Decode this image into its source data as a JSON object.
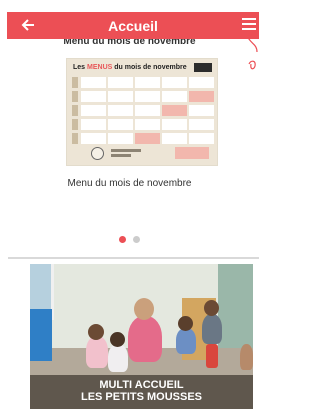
{
  "header": {
    "title": "Accueil",
    "back_icon": "arrow-left-icon",
    "menu_icon": "hamburger-icon",
    "bar_color": "#ec4f55"
  },
  "section": {
    "title": "Menu du mois de novembre"
  },
  "menu_card": {
    "image_heading_prefix": "Les",
    "image_heading_highlight": "MENUS",
    "image_heading_suffix": "du mois de novembre",
    "caption": "Menu du mois de novembre"
  },
  "carousel": {
    "count": 2,
    "active_index": 0,
    "active_color": "#ec4f55",
    "inactive_color": "#cccccc"
  },
  "photo_card": {
    "line1": "MULTI ACCUEIL",
    "line2": "LES PETITS MOUSSES"
  }
}
